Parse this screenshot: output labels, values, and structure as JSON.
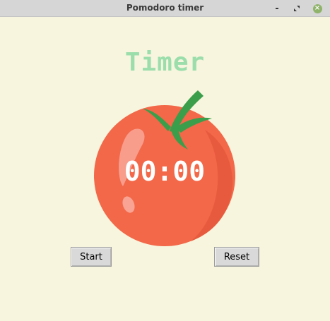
{
  "window": {
    "title": "Pomodoro timer",
    "controls": [
      "minimize-icon",
      "maximize-icon",
      "close-icon"
    ]
  },
  "app": {
    "title": "Timer",
    "timer_display": "00:00",
    "start_label": "Start",
    "reset_label": "Reset"
  },
  "colors": {
    "background": "#f7f5dd",
    "title_green": "#9bdeac",
    "tomato": "#f26849",
    "leaf": "#3a9e4a"
  }
}
